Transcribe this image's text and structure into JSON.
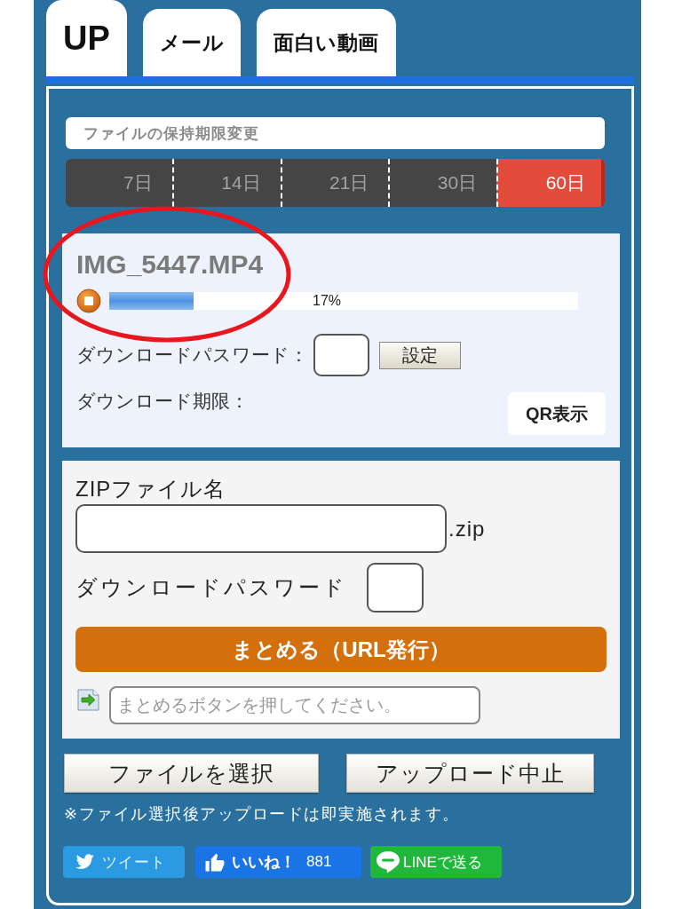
{
  "tabs": [
    {
      "label": "UP",
      "selected": true
    },
    {
      "label": "メール",
      "selected": false
    },
    {
      "label": "面白い動画",
      "selected": false
    }
  ],
  "retention": {
    "title": "ファイルの保持期限変更",
    "options": [
      {
        "label": "7日",
        "selected": false
      },
      {
        "label": "14日",
        "selected": false
      },
      {
        "label": "21日",
        "selected": false
      },
      {
        "label": "30日",
        "selected": false
      },
      {
        "label": "60日",
        "selected": true
      }
    ]
  },
  "file": {
    "name": "IMG_5447.MP4",
    "progress": {
      "level": 0.18,
      "reading": "17%"
    },
    "password_label": "ダウンロードパスワード：",
    "set_button": "設定",
    "expiry_label": "ダウンロード期限：",
    "qr_button": "QR表示"
  },
  "zip": {
    "name_label": "ZIPファイル名",
    "extension": ".zip",
    "password_label": "ダウンロードパスワード",
    "submit_button": "まとめる（URL発行）",
    "result_field": {
      "placeholder": "まとめるボタンを押してください。"
    }
  },
  "actions": [
    "ファイルを選択",
    "アップロード中止"
  ],
  "note": "※ファイル選択後アップロードは即実施されます。",
  "share": [
    {
      "kind": "tweet",
      "label": "ツイート"
    },
    {
      "kind": "like",
      "label": "いいね！",
      "count": "881"
    },
    {
      "kind": "send",
      "label": "LINEで送る"
    }
  ],
  "annotations": [
    {
      "kind": "ellipse"
    }
  ]
}
